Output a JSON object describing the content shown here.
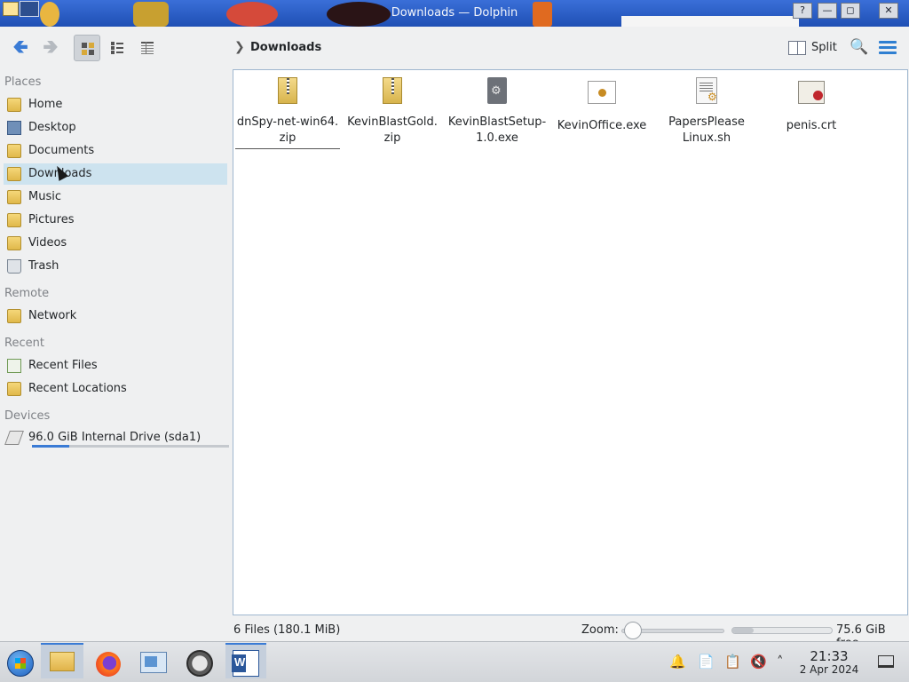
{
  "window": {
    "title": "Downloads — Dolphin",
    "help_label": "?",
    "minimize_label": "—",
    "maximize_label": "◻",
    "close_label": "✕"
  },
  "toolbar": {
    "back_label": "Back",
    "forward_label": "Forward",
    "breadcrumb": "Downloads",
    "split_label": "Split",
    "search_label": "Search",
    "menu_label": "Menu"
  },
  "sidebar": {
    "places_header": "Places",
    "places": [
      {
        "label": "Home",
        "icon": "home-folder-icon"
      },
      {
        "label": "Desktop",
        "icon": "desktop-icon"
      },
      {
        "label": "Documents",
        "icon": "documents-folder-icon"
      },
      {
        "label": "Downloads",
        "icon": "downloads-folder-icon",
        "active": true
      },
      {
        "label": "Music",
        "icon": "music-folder-icon"
      },
      {
        "label": "Pictures",
        "icon": "pictures-folder-icon"
      },
      {
        "label": "Videos",
        "icon": "videos-folder-icon"
      },
      {
        "label": "Trash",
        "icon": "trash-icon"
      }
    ],
    "remote_header": "Remote",
    "remote": [
      {
        "label": "Network",
        "icon": "network-folder-icon"
      }
    ],
    "recent_header": "Recent",
    "recent": [
      {
        "label": "Recent Files",
        "icon": "recent-files-icon"
      },
      {
        "label": "Recent Locations",
        "icon": "recent-locations-icon"
      }
    ],
    "devices_header": "Devices",
    "devices": [
      {
        "label": "96.0 GiB Internal Drive (sda1)",
        "icon": "drive-icon",
        "usage_fraction": 0.19
      }
    ]
  },
  "files": [
    {
      "name": "dnSpy-net-win64.zip",
      "line1": "dnSpy-net-win64.",
      "line2": "zip",
      "type": "zip-archive-icon"
    },
    {
      "name": "KevinBlastGold.zip",
      "line1": "KevinBlastGold.",
      "line2": "zip",
      "type": "zip-archive-icon"
    },
    {
      "name": "KevinBlastSetup-1.0.exe",
      "line1": "KevinBlastSetup-",
      "line2": "1.0.exe",
      "type": "executable-icon"
    },
    {
      "name": "KevinOffice.exe",
      "line1": "KevinOffice.exe",
      "line2": "",
      "type": "application-icon"
    },
    {
      "name": "PapersPleaseLinux.sh",
      "line1": "PapersPlease",
      "line2": "Linux.sh",
      "type": "shell-script-icon"
    },
    {
      "name": "penis.crt",
      "line1": "penis.crt",
      "line2": "",
      "type": "certificate-icon"
    }
  ],
  "status": {
    "summary": "6 Files (180.1 MiB)",
    "zoom_label": "Zoom:",
    "free_space": "75.6 GiB free",
    "disk_used_fraction": 0.21
  },
  "taskbar": {
    "apps": [
      "start-menu-icon",
      "file-manager-icon",
      "firefox-icon",
      "system-settings-icon",
      "gauge-app-icon",
      "word-icon"
    ],
    "clock_time": "21:33",
    "clock_date": "2 Apr 2024"
  },
  "colors": {
    "accent": "#3a7bd5",
    "selection": "#cde3ef",
    "titlebar": "#1f4fb4"
  }
}
